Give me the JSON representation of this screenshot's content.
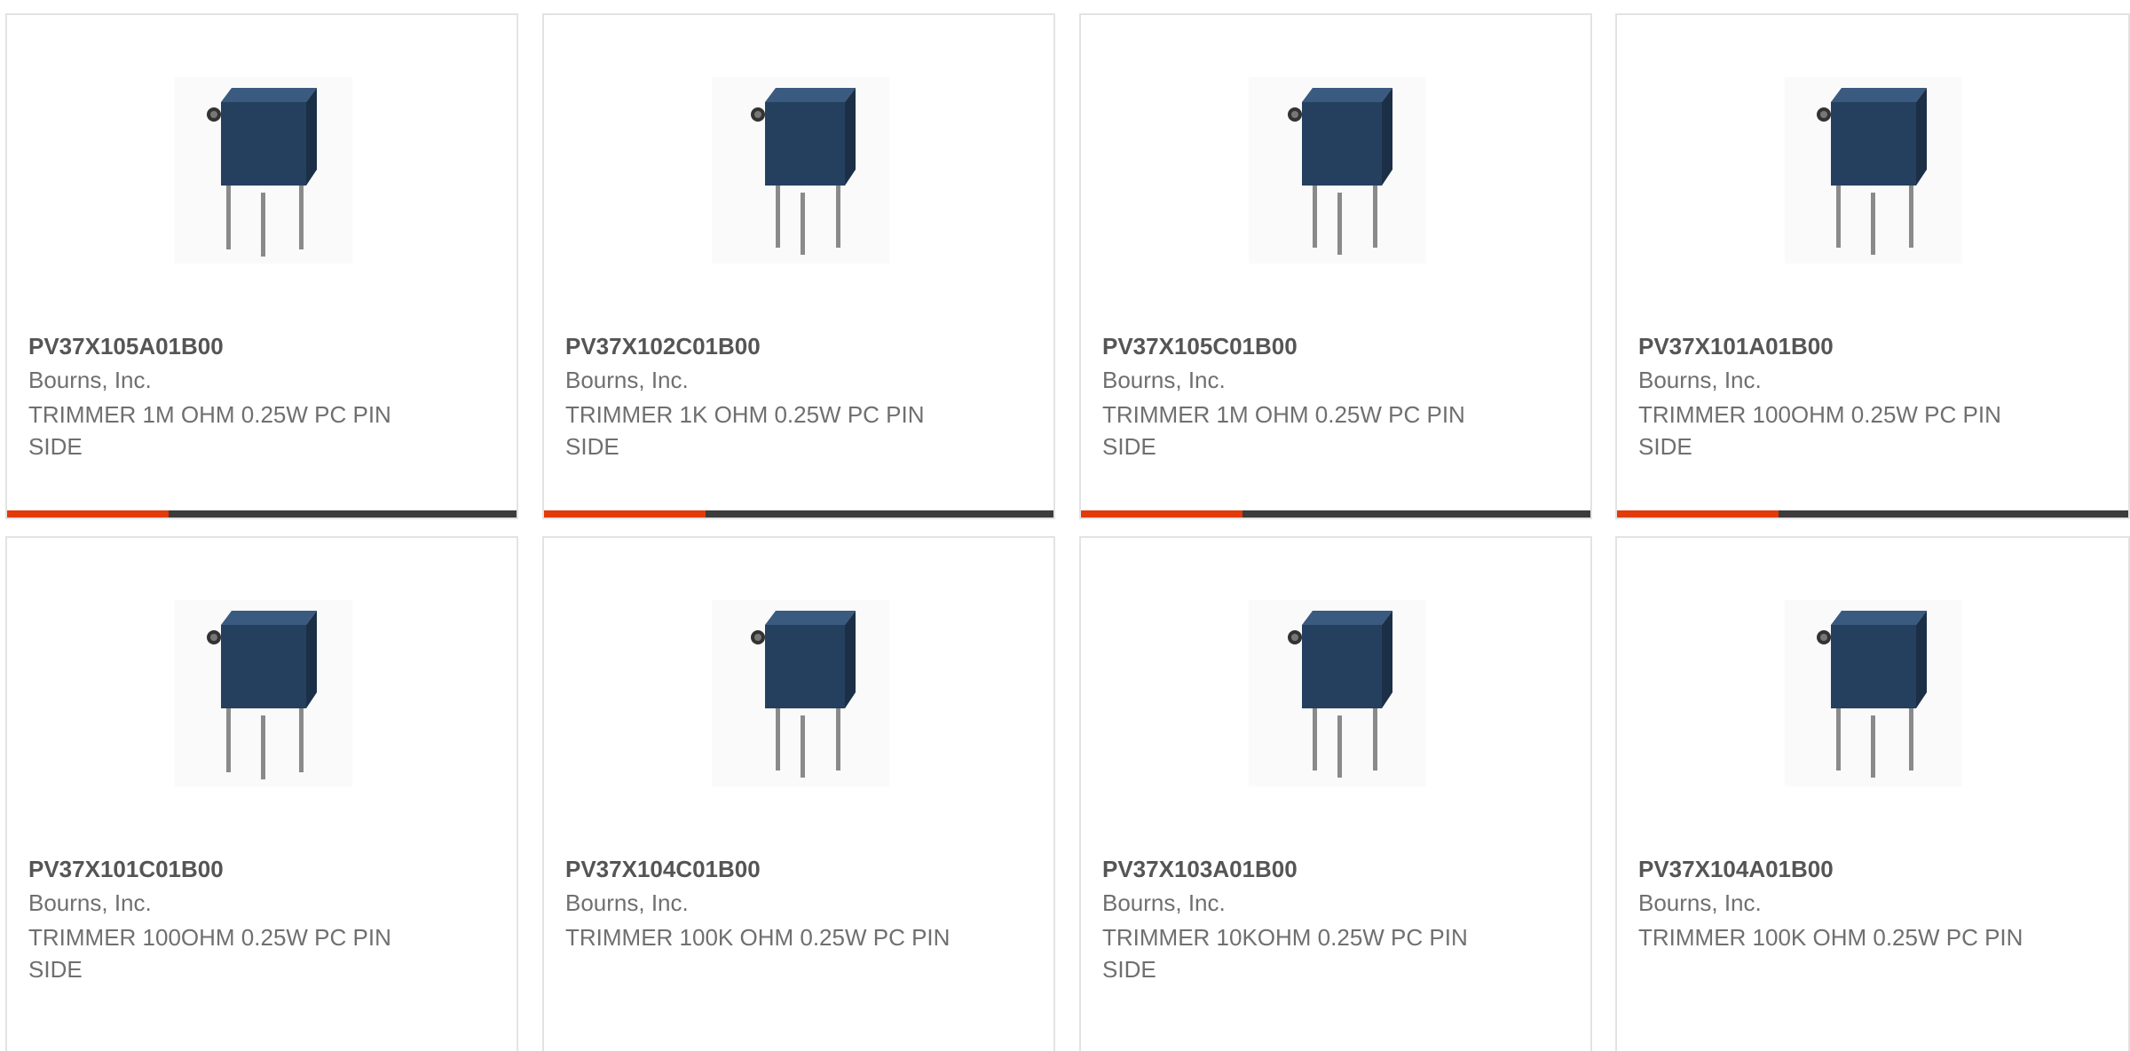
{
  "products": [
    {
      "part_number": "PV37X105A01B00",
      "manufacturer": "Bourns, Inc.",
      "description": "TRIMMER 1M OHM 0.25W PC PIN SIDE",
      "image_icon": "trimmer-potentiometer-icon"
    },
    {
      "part_number": "PV37X102C01B00",
      "manufacturer": "Bourns, Inc.",
      "description": "TRIMMER 1K OHM 0.25W PC PIN SIDE",
      "image_icon": "trimmer-potentiometer-icon"
    },
    {
      "part_number": "PV37X105C01B00",
      "manufacturer": "Bourns, Inc.",
      "description": "TRIMMER 1M OHM 0.25W PC PIN SIDE",
      "image_icon": "trimmer-potentiometer-icon"
    },
    {
      "part_number": "PV37X101A01B00",
      "manufacturer": "Bourns, Inc.",
      "description": "TRIMMER 100OHM 0.25W PC PIN SIDE",
      "image_icon": "trimmer-potentiometer-icon"
    },
    {
      "part_number": "PV37X101C01B00",
      "manufacturer": "Bourns, Inc.",
      "description": "TRIMMER 100OHM 0.25W PC PIN SIDE",
      "image_icon": "trimmer-potentiometer-icon"
    },
    {
      "part_number": "PV37X104C01B00",
      "manufacturer": "Bourns, Inc.",
      "description": "TRIMMER 100K OHM 0.25W PC PIN",
      "image_icon": "trimmer-potentiometer-icon"
    },
    {
      "part_number": "PV37X103A01B00",
      "manufacturer": "Bourns, Inc.",
      "description": "TRIMMER 10KOHM 0.25W PC PIN SIDE",
      "image_icon": "trimmer-potentiometer-icon"
    },
    {
      "part_number": "PV37X104A01B00",
      "manufacturer": "Bourns, Inc.",
      "description": "TRIMMER 100K OHM 0.25W PC PIN",
      "image_icon": "trimmer-potentiometer-icon"
    }
  ],
  "colors": {
    "accent": "#e23a0a",
    "bar": "#3c3c3c",
    "component_body": "#25405f"
  }
}
